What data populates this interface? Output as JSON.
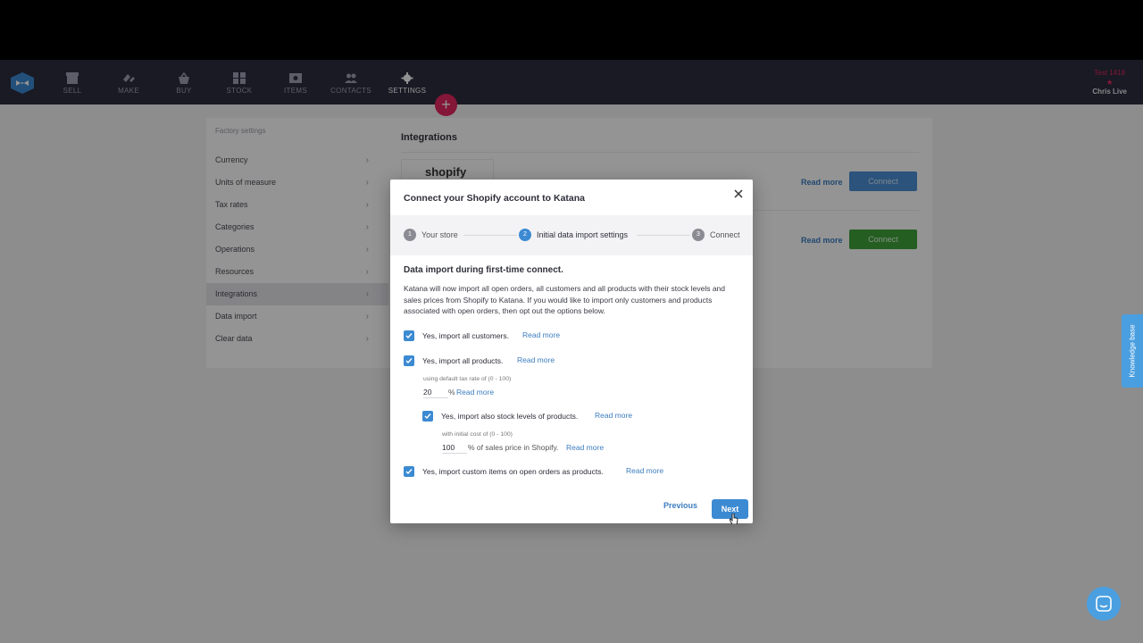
{
  "nav": {
    "items": [
      {
        "label": "SELL",
        "icon": "store-icon"
      },
      {
        "label": "MAKE",
        "icon": "make-icon"
      },
      {
        "label": "BUY",
        "icon": "basket-icon"
      },
      {
        "label": "STOCK",
        "icon": "stock-icon"
      },
      {
        "label": "ITEMS",
        "icon": "items-icon"
      },
      {
        "label": "CONTACTS",
        "icon": "contacts-icon"
      },
      {
        "label": "SETTINGS",
        "icon": "gear-icon"
      }
    ],
    "user_company": "Test 1418",
    "user_name": "Chris Live",
    "fab_label": "+"
  },
  "settings": {
    "header": "Factory settings",
    "items": [
      "Currency",
      "Units of measure",
      "Tax rates",
      "Categories",
      "Operations",
      "Resources",
      "Integrations",
      "Data import",
      "Clear data"
    ],
    "active": "Integrations"
  },
  "integrations": {
    "title": "Integrations",
    "shopify_logo_text": "shopify",
    "read_more": "Read more",
    "connect": "Connect"
  },
  "knowledge_base": "Knowledge base",
  "modal": {
    "title": "Connect your Shopify account to Katana",
    "steps": [
      {
        "num": "1",
        "label": "Your store"
      },
      {
        "num": "2",
        "label": "Initial data import settings"
      },
      {
        "num": "3",
        "label": "Connect"
      }
    ],
    "active_step": 2,
    "section_title": "Data import during first-time connect.",
    "description": "Katana will now import all open orders, all customers and all products with their stock levels and sales prices from Shopify to Katana. If you would like to import only customers and products associated with open orders, then opt out the options below.",
    "options": {
      "customers": {
        "label": "Yes, import all customers.",
        "checked": true
      },
      "products": {
        "label": "Yes, import all products.",
        "checked": true
      },
      "tax_label": "using default tax rate of (0 - 100)",
      "tax_value": "20",
      "tax_suffix": "%",
      "stock": {
        "label": "Yes, import also stock levels of products.",
        "checked": true
      },
      "cost_label": "with initial cost of (0 - 100)",
      "cost_value": "100",
      "cost_suffix": "% of sales price in Shopify.",
      "custom": {
        "label": "Yes, import custom items on open orders as products.",
        "checked": true
      }
    },
    "read_more": "Read more",
    "previous": "Previous",
    "next": "Next"
  },
  "colors": {
    "nav_bg": "#2b2d3e",
    "accent_blue": "#3c8ad2",
    "brand_pink": "#e3275f",
    "connect_green": "#3ea33a"
  }
}
